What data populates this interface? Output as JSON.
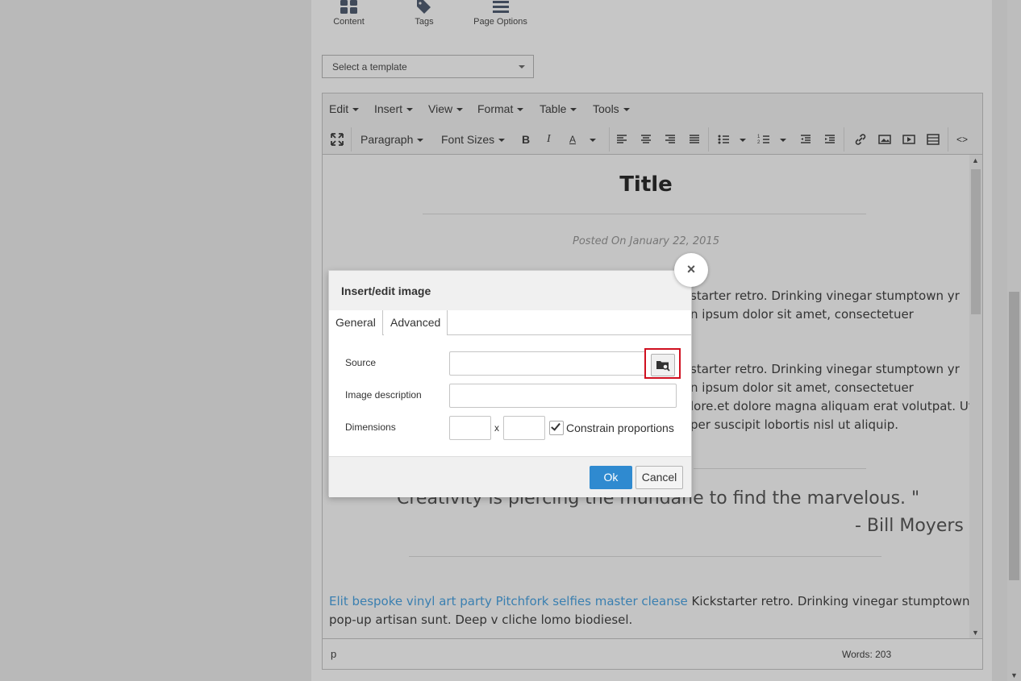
{
  "top_tabs": [
    {
      "label": "Content",
      "icon": "grid-icon"
    },
    {
      "label": "Tags",
      "icon": "tag-icon"
    },
    {
      "label": "Page Options",
      "icon": "list-icon"
    }
  ],
  "template_select": {
    "value": "Select a template"
  },
  "menubar": [
    "Edit",
    "Insert",
    "View",
    "Format",
    "Table",
    "Tools"
  ],
  "toolbar": {
    "block_format": "Paragraph",
    "font_sizes": "Font Sizes",
    "bold": "B",
    "italic": "I",
    "text_color": "A",
    "source_code": "<>"
  },
  "document": {
    "title": "Title",
    "posted": "Posted On January 22, 2015",
    "para1_right_line1": "starter retro. Drinking vinegar stumptown yr",
    "para1_right_line2": "n ipsum dolor sit amet, consectetuer",
    "para2_right_line1": "starter retro. Drinking vinegar stumptown yr",
    "para2_right_line2": "n ipsum dolor sit amet, consectetuer",
    "para2_right_line3": "lore.et dolore magna aliquam erat volutpat. Ut",
    "para2_right_line4": "per suscipit lobortis nisl ut aliquip.",
    "quote": "Creativity is piercing the mundane to find the marvelous. \"",
    "quote_author": "- Bill Moyers",
    "para3_link": "Elit bespoke vinyl art party Pitchfork selfies master cleanse",
    "para3_text": " Kickstarter retro. Drinking vinegar stumptown yr",
    "para3_line2": "pop-up artisan sunt. Deep v cliche lomo biodiesel."
  },
  "statusbar": {
    "path": "p",
    "words": "Words: 203"
  },
  "dialog": {
    "title": "Insert/edit image",
    "close": "×",
    "tabs": [
      "General",
      "Advanced"
    ],
    "source_label": "Source",
    "source_value": "",
    "description_label": "Image description",
    "description_value": "",
    "dimensions_label": "Dimensions",
    "width_value": "",
    "height_value": "",
    "x_separator": "x",
    "constrain_label": "Constrain proportions",
    "constrain_checked": true,
    "ok": "Ok",
    "cancel": "Cancel"
  },
  "colors": {
    "accent": "#2f8ad0",
    "highlight": "#d01020",
    "link": "#3a7fb0"
  }
}
